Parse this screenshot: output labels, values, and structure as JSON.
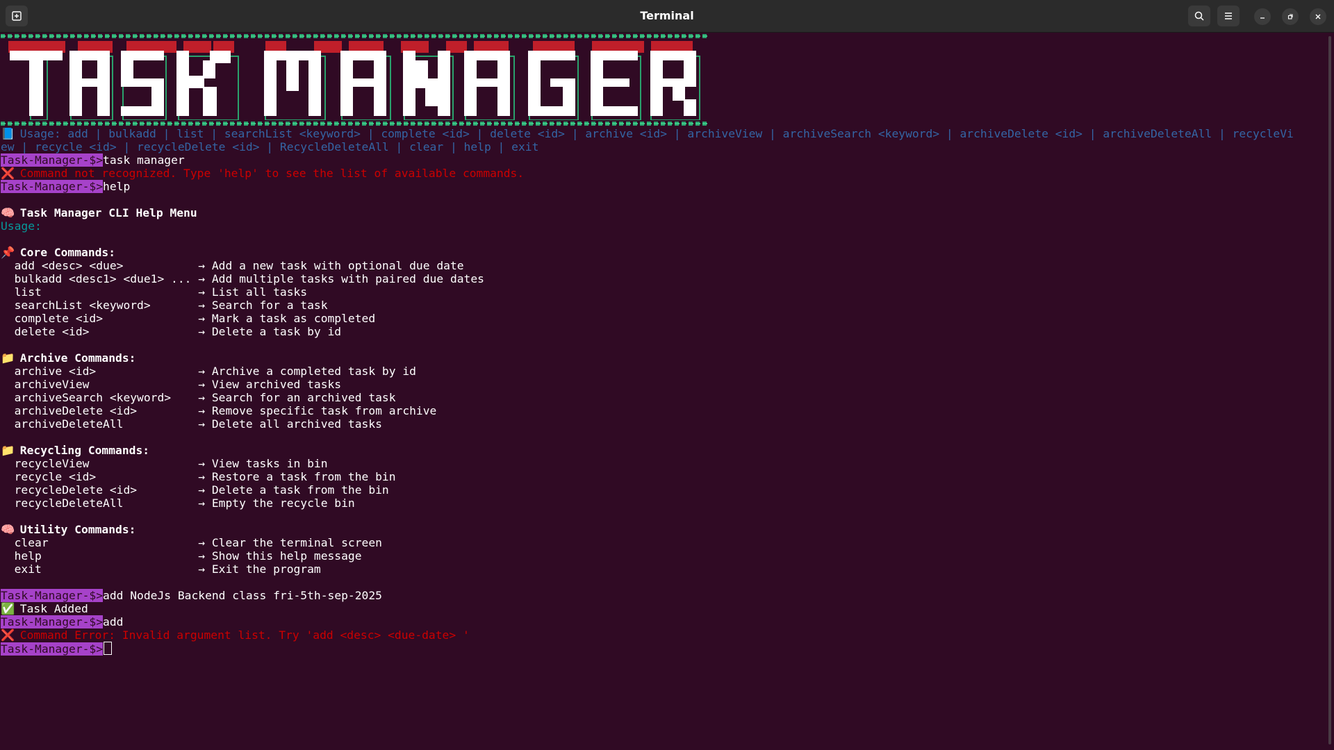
{
  "window": {
    "title": "Terminal"
  },
  "prompt": "Task-Manager-$>",
  "banner_text": "TASK MANAGER",
  "usage_bar": {
    "line1": " Usage: add | bulkadd | list | searchList <keyword> | complete <id> | delete <id> | archive <id> | archiveView | archiveSearch <keyword> | archiveDelete <id> | archiveDeleteAll | recycleVi",
    "line2": "ew | recycle <id> | recycleDelete <id> | RecycleDeleteAll | clear | help | exit"
  },
  "session": {
    "cmd1": "task manager",
    "err1": " Command not recognized. Type 'help' to see the list of available commands.",
    "cmd2": "help",
    "help_title": " Task Manager CLI Help Menu",
    "usage_label": "Usage:",
    "core_title": " Core Commands:",
    "core": [
      {
        "text": "  add <desc> <due>           → Add a new task with optional due date"
      },
      {
        "text": "  bulkadd <desc1> <due1> ... → Add multiple tasks with paired due dates"
      },
      {
        "text": "  list                       → List all tasks"
      },
      {
        "text": "  searchList <keyword>       → Search for a task"
      },
      {
        "text": "  complete <id>              → Mark a task as completed"
      },
      {
        "text": "  delete <id>                → Delete a task by id"
      }
    ],
    "archive_title": " Archive Commands:",
    "archive": [
      {
        "text": "  archive <id>               → Archive a completed task by id"
      },
      {
        "text": "  archiveView                → View archived tasks"
      },
      {
        "text": "  archiveSearch <keyword>    → Search for an archived task"
      },
      {
        "text": "  archiveDelete <id>         → Remove specific task from archive"
      },
      {
        "text": "  archiveDeleteAll           → Delete all archived tasks"
      }
    ],
    "recycle_title": " Recycling Commands:",
    "recycle": [
      {
        "text": "  recycleView                → View tasks in bin"
      },
      {
        "text": "  recycle <id>               → Restore a task from the bin"
      },
      {
        "text": "  recycleDelete <id>         → Delete a task from the bin"
      },
      {
        "text": "  recycleDeleteAll           → Empty the recycle bin"
      }
    ],
    "utility_title": " Utility Commands:",
    "utility": [
      {
        "text": "  clear                      → Clear the terminal screen"
      },
      {
        "text": "  help                       → Show this help message"
      },
      {
        "text": "  exit                       → Exit the program"
      }
    ],
    "cmd3": "add NodeJs Backend class fri-5th-sep-2025",
    "ok1": " Task Added",
    "cmd4": "add",
    "err2": " Command Error: Invalid argument list. Try 'add <desc> <due-date> '"
  },
  "icons": {
    "book": "blue-book-icon",
    "cross": "red-cross-icon",
    "brain": "brain-icon",
    "pin": "pushpin-icon",
    "folder": "folder-icon",
    "check": "green-check-icon"
  },
  "colors": {
    "background": "#300a24",
    "prompt_bg": "#a642c9",
    "usage": "#3465a4",
    "error": "#cc0000",
    "info": "#06989a"
  }
}
